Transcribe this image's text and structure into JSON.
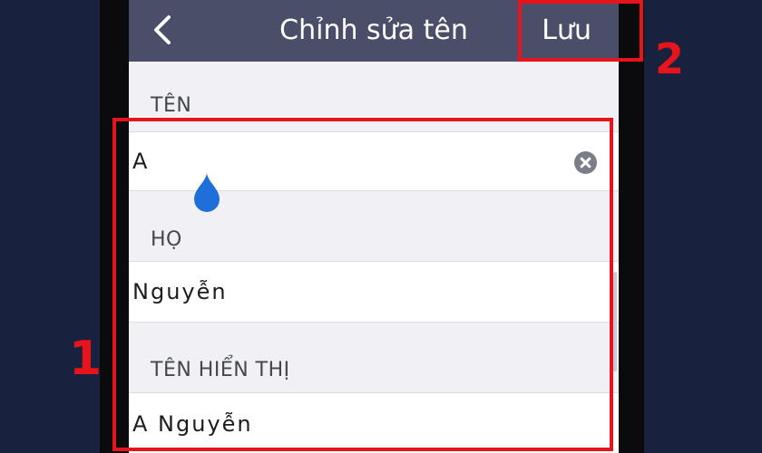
{
  "header": {
    "title": "Chỉnh sửa tên",
    "save_label": "Lưu",
    "back_icon": "chevron-left-icon"
  },
  "form": {
    "first_name_label": "TÊN",
    "first_name_value": "A",
    "last_name_label": "HỌ",
    "last_name_value": "Nguyễn",
    "display_name_label": "TÊN HIỂN THỊ",
    "display_name_value": "A Nguyễn",
    "clear_icon": "clear-circle-icon"
  },
  "annotations": {
    "step_1": "1",
    "step_2": "2",
    "highlight_color": "#e8141c"
  },
  "colors": {
    "background": "#18223f",
    "header_bar": "#4b4e68",
    "cursor_handle": "#1e6fd9"
  }
}
